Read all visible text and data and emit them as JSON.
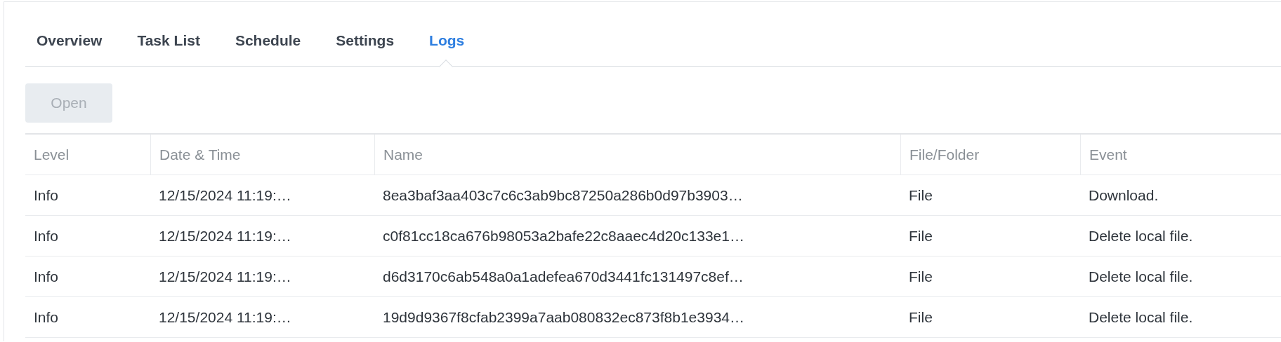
{
  "tabs": [
    {
      "label": "Overview",
      "selected": false
    },
    {
      "label": "Task List",
      "selected": false
    },
    {
      "label": "Schedule",
      "selected": false
    },
    {
      "label": "Settings",
      "selected": false
    },
    {
      "label": "Logs",
      "selected": true
    }
  ],
  "toolbar": {
    "open_button": {
      "label": "Open",
      "disabled": true
    }
  },
  "table": {
    "columns": [
      "Level",
      "Date & Time",
      "Name",
      "File/Folder",
      "Event"
    ],
    "rows": [
      [
        "Info",
        "12/15/2024 11:19:…",
        "8ea3baf3aa403c7c6c3ab9bc87250a286b0d97b3903…",
        "File",
        "Download."
      ],
      [
        "Info",
        "12/15/2024 11:19:…",
        "c0f81cc18ca676b98053a2bafe22c8aaec4d20c133e1…",
        "File",
        "Delete local file."
      ],
      [
        "Info",
        "12/15/2024 11:19:…",
        "d6d3170c6ab548a0a1adefea670d3441fc131497c8ef…",
        "File",
        "Delete local file."
      ],
      [
        "Info",
        "12/15/2024 11:19:…",
        "19d9d9367f8cfab2399a7aab080832ec873f8b1e3934…",
        "File",
        "Delete local file."
      ]
    ]
  }
}
